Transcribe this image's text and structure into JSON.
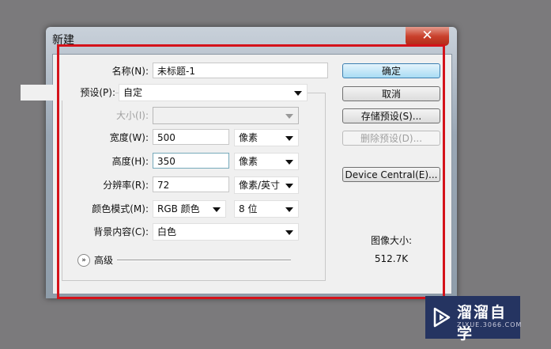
{
  "window": {
    "title": "新建",
    "close": "✕"
  },
  "form": {
    "name_label": "名称(N):",
    "name_value": "未标题-1",
    "preset_label": "预设(P):",
    "preset_value": "自定",
    "size_label": "大小(I):",
    "width_label": "宽度(W):",
    "width_value": "500",
    "width_unit": "像素",
    "height_label": "高度(H):",
    "height_value": "350",
    "height_unit": "像素",
    "resolution_label": "分辨率(R):",
    "resolution_value": "72",
    "resolution_unit": "像素/英寸",
    "color_mode_label": "颜色模式(M):",
    "color_mode_value": "RGB 颜色",
    "bit_depth": "8 位",
    "background_label": "背景内容(C):",
    "background_value": "白色",
    "advanced_label": "高级"
  },
  "buttons": {
    "ok": "确定",
    "cancel": "取消",
    "save_preset": "存储预设(S)...",
    "delete_preset": "删除预设(D)...",
    "device_central": "Device Central(E)..."
  },
  "image_size": {
    "label": "图像大小:",
    "value": "512.7K"
  },
  "watermark": {
    "name": "溜溜自学",
    "url": "ZIXUE.3066.COM"
  }
}
